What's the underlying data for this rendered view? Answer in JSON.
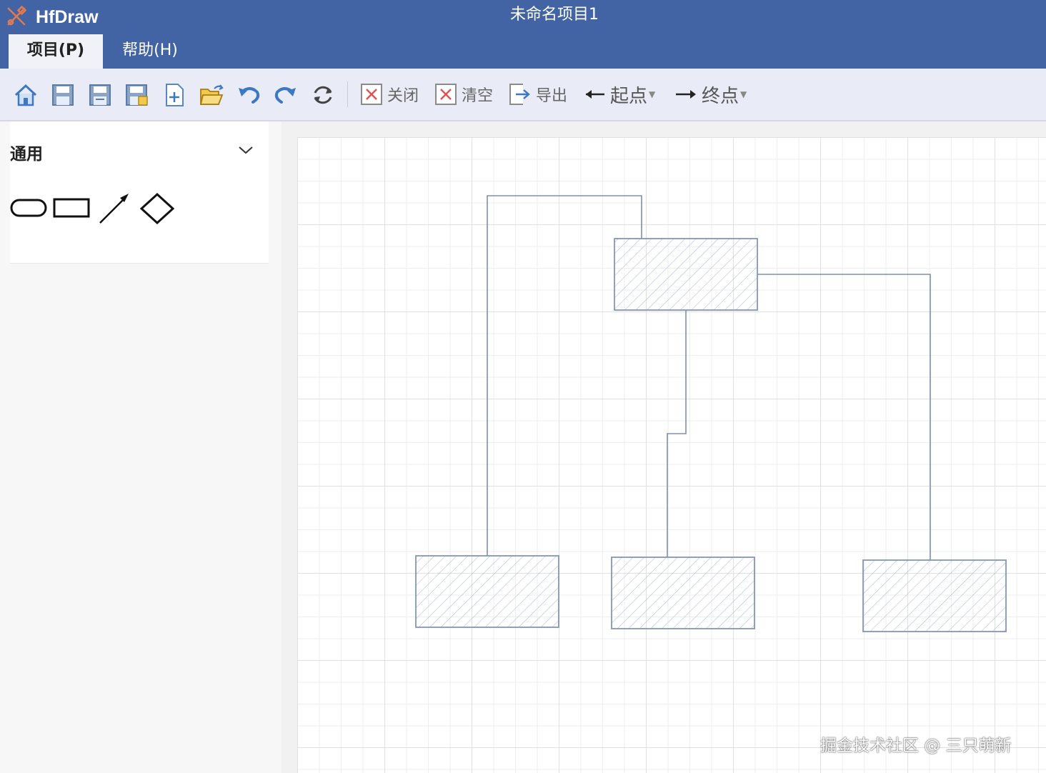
{
  "app": {
    "name": "HfDraw",
    "document_title": "未命名项目1"
  },
  "menu_tabs": [
    {
      "label": "项目(P)",
      "active": true
    },
    {
      "label": "帮助(H)",
      "active": false
    }
  ],
  "toolbar": {
    "icons": [
      "home-icon",
      "save-icon",
      "save-as-icon",
      "save-local-icon",
      "new-file-icon",
      "open-folder-icon",
      "undo-icon",
      "redo-icon",
      "refresh-icon"
    ],
    "close_label": "关闭",
    "clear_label": "清空",
    "export_label": "导出",
    "start_label": "起点",
    "end_label": "终点"
  },
  "sidebar": {
    "panel_title": "通用",
    "shapes": [
      "rounded-rectangle",
      "rectangle",
      "arrow",
      "diamond"
    ]
  },
  "watermark": "掘金技术社区 @ 三只萌新",
  "colors": {
    "titlebar": "#4263a4",
    "toolbar": "#e9ecf6",
    "node_stroke": "#8497b8",
    "connector": "#7e8fad"
  }
}
